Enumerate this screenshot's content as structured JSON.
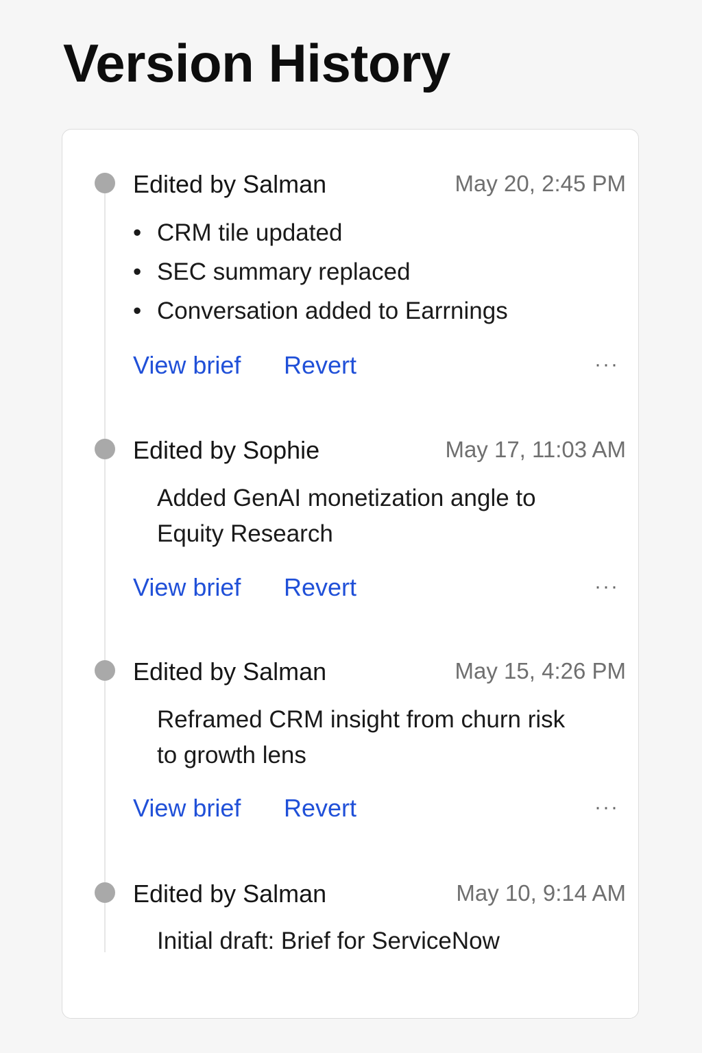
{
  "page": {
    "title": "Version History"
  },
  "entries": [
    {
      "editor": "Edited by Salman",
      "timestamp": "May 20, 2:45 PM",
      "changes": [
        "CRM tile updated",
        "SEC summary replaced",
        "Conversation added to Earrnings"
      ],
      "view_label": "View brief",
      "revert_label": "Revert",
      "more_label": "···"
    },
    {
      "editor": "Edited by Sophie",
      "timestamp": "May 17, 11:03 AM",
      "description": "Added GenAI monetization angle to Equity Research",
      "view_label": "View brief",
      "revert_label": "Revert",
      "more_label": "···"
    },
    {
      "editor": "Edited by Salman",
      "timestamp": "May 15, 4:26 PM",
      "description": "Reframed CRM insight from churn risk to growth lens",
      "view_label": "View brief",
      "revert_label": "Revert",
      "more_label": "···"
    },
    {
      "editor": "Edited by Salman",
      "timestamp": "May 10, 9:14 AM",
      "description": "Initial draft: Brief for ServiceNow"
    }
  ],
  "colors": {
    "link": "#2050d8",
    "dot": "#a9a9a9",
    "timestamp": "#6f6f6f",
    "background": "#f6f6f6"
  }
}
